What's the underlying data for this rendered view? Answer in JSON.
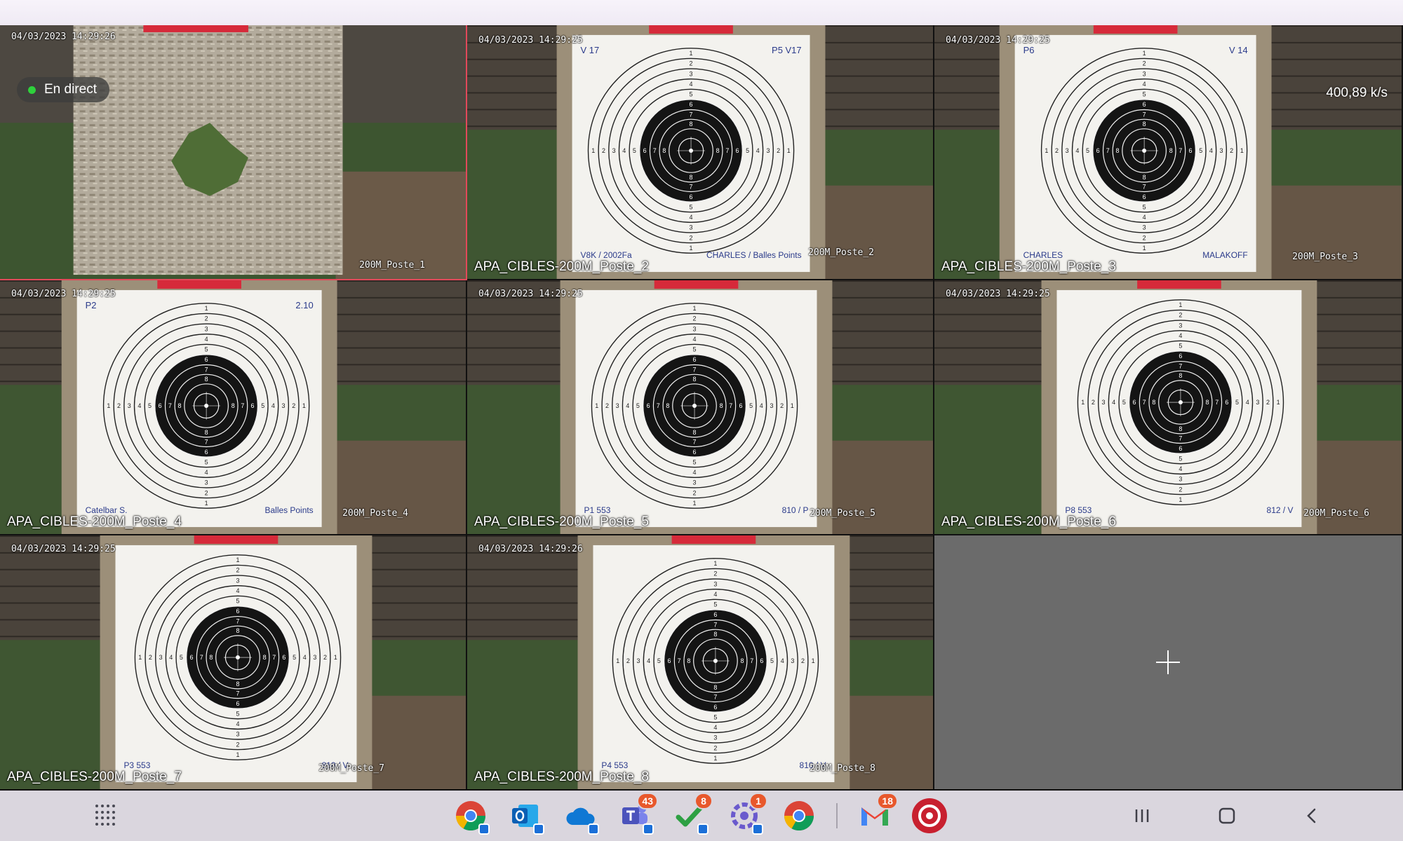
{
  "live": {
    "label": "En direct",
    "dot_color": "#2ed13c"
  },
  "transfer_rate": "400,89 k/s",
  "cameras": [
    {
      "timestamp": "04/03/2023 14:29:26",
      "overlay": "200M_Poste_1",
      "name": ""
    },
    {
      "timestamp": "04/03/2023 14:29:25",
      "overlay": "200M_Poste_2",
      "name": "APA_CIBLES-200M_Poste_2"
    },
    {
      "timestamp": "04/03/2023 14:29:25",
      "overlay": "200M_Poste_3",
      "name": "APA_CIBLES-200M_Poste_3"
    },
    {
      "timestamp": "04/03/2023 14:29:25",
      "overlay": "200M_Poste_4",
      "name": "APA_CIBLES-200M_Poste_4"
    },
    {
      "timestamp": "04/03/2023 14:29:25",
      "overlay": "200M_Poste_5",
      "name": "APA_CIBLES-200M_Poste_5"
    },
    {
      "timestamp": "04/03/2023 14:29:25",
      "overlay": "200M_Poste_6",
      "name": "APA_CIBLES-200M_Poste_6"
    },
    {
      "timestamp": "04/03/2023 14:29:25",
      "overlay": "200M_Poste_7",
      "name": "APA_CIBLES-200M_Poste_7"
    },
    {
      "timestamp": "04/03/2023 14:29:26",
      "overlay": "200M_Poste_8",
      "name": "APA_CIBLES-200M_Poste_8"
    }
  ],
  "target_marks": {
    "cam2": {
      "top_left": "V 17",
      "top_right": "P5 V17",
      "bottom_left": "V8K / 2002Fa",
      "bottom_right": "CHARLES / Balles Points"
    },
    "cam3": {
      "top_left": "P6",
      "top_right": "V 14",
      "bottom_left": "CHARLES",
      "bottom_right": "MALAKOFF"
    },
    "cam4": {
      "top_left": "P2",
      "top_right": "2.10",
      "bottom_left": "Catelbar S.",
      "bottom_right": "Balles Points"
    },
    "cam5": {
      "top_left": "",
      "top_right": "",
      "bottom_left": "P1 553",
      "bottom_right": "810 / P"
    },
    "cam6": {
      "top_left": "",
      "top_right": "",
      "bottom_left": "P8 553",
      "bottom_right": "812 / V"
    },
    "cam7": {
      "top_left": "",
      "top_right": "",
      "bottom_left": "P3 553",
      "bottom_right": "810 / V"
    },
    "cam8": {
      "top_left": "",
      "top_right": "",
      "bottom_left": "P4 553",
      "bottom_right": "810 / V"
    }
  },
  "ring_numbers": [
    "1",
    "2",
    "3",
    "4",
    "5",
    "6",
    "7",
    "8"
  ],
  "taskbar": {
    "apps": [
      {
        "name": "chrome",
        "badge": ""
      },
      {
        "name": "outlook",
        "badge": ""
      },
      {
        "name": "onedrive",
        "badge": ""
      },
      {
        "name": "teams",
        "badge": "43"
      },
      {
        "name": "tasks",
        "badge": "8"
      },
      {
        "name": "settings",
        "badge": "1"
      },
      {
        "name": "chrome-2",
        "badge": ""
      },
      {
        "name": "gmail",
        "badge": "18"
      },
      {
        "name": "camera-app",
        "badge": ""
      }
    ]
  },
  "colors": {
    "selected_border": "#e2495a",
    "badge": "#e8582c",
    "empty_tile": "#6b6b6b"
  }
}
